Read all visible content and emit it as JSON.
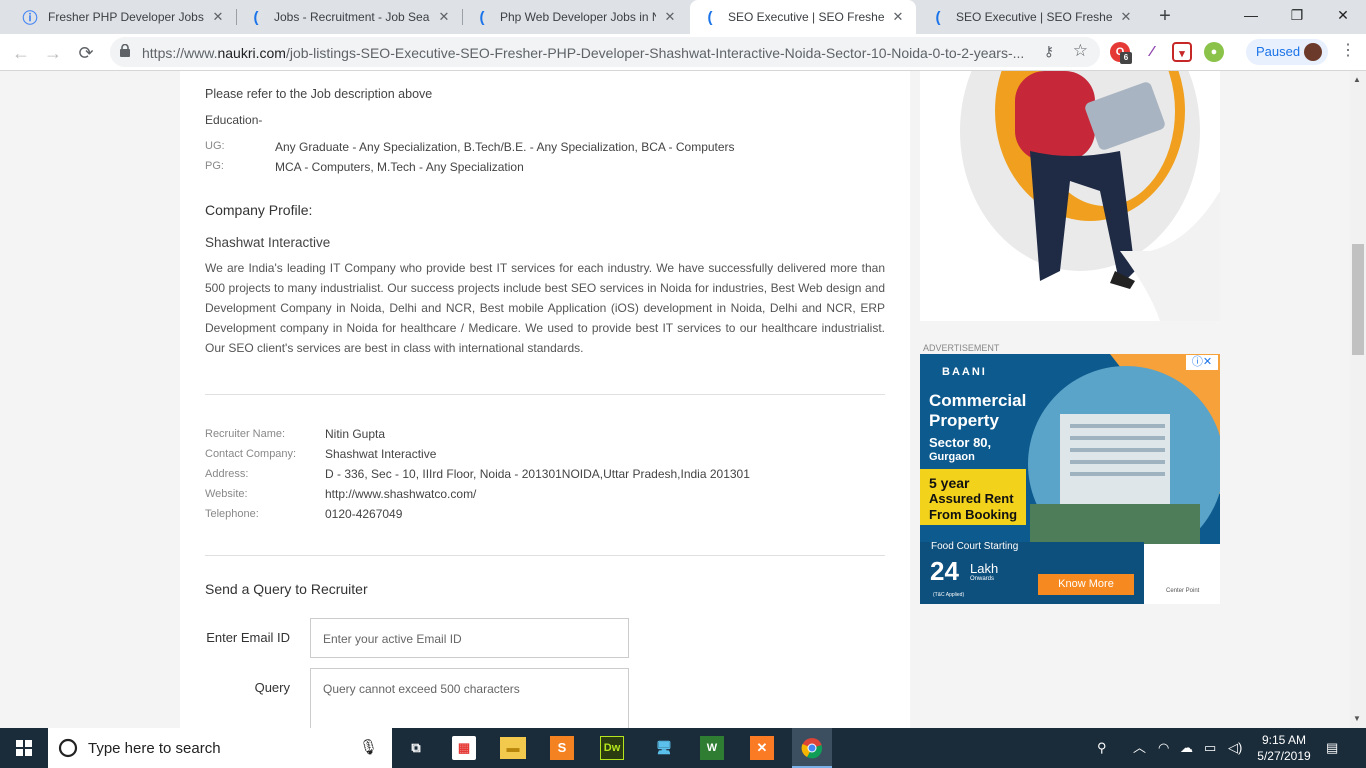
{
  "browser": {
    "tabs": [
      {
        "title": "Fresher PHP Developer Jobs in",
        "active": false
      },
      {
        "title": "Jobs - Recruitment - Job Searc",
        "active": false
      },
      {
        "title": "Php Web Developer Jobs in No",
        "active": false
      },
      {
        "title": "SEO Executive | SEO Fresher | P",
        "active": true
      },
      {
        "title": "SEO Executive | SEO Fresher | P",
        "active": false
      }
    ],
    "url_prefix": "https://www.",
    "url_host": "naukri.com",
    "url_path": "/job-listings-SEO-Executive-SEO-Fresher-PHP-Developer-Shashwat-Interactive-Noida-Sector-10-Noida-0-to-2-years-...",
    "profile_status": "Paused",
    "ext_badge": "6"
  },
  "job": {
    "refer_text": "Please refer to the Job description above",
    "education_heading": "Education-",
    "ug_label": "UG:",
    "ug_value": "Any Graduate - Any Specialization, B.Tech/B.E. - Any Specialization, BCA - Computers",
    "pg_label": "PG:",
    "pg_value": "MCA - Computers, M.Tech - Any Specialization",
    "company_profile_heading": "Company Profile:",
    "company_name": "Shashwat Interactive",
    "company_description": "We are India's leading IT Company who provide best IT services for each industry. We have successfully delivered more than 500 projects to many industrialist. Our success projects include best SEO services in Noida for industries, Best Web design and Development Company in Noida, Delhi and NCR, Best mobile Application (iOS) development in Noida, Delhi and NCR, ERP Development company in Noida for healthcare / Medicare. We used to provide best IT services to our healthcare industrialist. Our SEO client's services are best in class with international standards."
  },
  "recruiter": {
    "name_label": "Recruiter Name:",
    "name": "Nitin Gupta",
    "company_label": "Contact Company:",
    "company": "Shashwat Interactive",
    "address_label": "Address:",
    "address": "D - 336, Sec - 10, IIIrd Floor, Noida - 201301NOIDA,Uttar Pradesh,India 201301",
    "website_label": "Website:",
    "website": "http://www.shashwatco.com/",
    "phone_label": "Telephone:",
    "phone": "0120-4267049"
  },
  "query_form": {
    "heading": "Send a Query to Recruiter",
    "email_label": "Enter Email ID",
    "email_placeholder": "Enter your active Email ID",
    "query_label": "Query",
    "query_placeholder": "Query cannot exceed 500 characters"
  },
  "sidebar": {
    "ad_label": "ADVERTISEMENT",
    "ad": {
      "brand": "BAANI",
      "headline1": "Commercial",
      "headline2": "Property",
      "location1": "Sector 80,",
      "location2": "Gurgaon",
      "offer1": "5 year",
      "offer2": "Assured Rent",
      "offer3": "From Booking",
      "food_court": "Food Court Starting",
      "price_num": "24",
      "price_unit": "Lakh",
      "price_sub": "Onwards",
      "tc": "(T&C Applied)",
      "cta": "Know More",
      "partner": "Center Point"
    }
  },
  "taskbar": {
    "search_placeholder": "Type here to search",
    "time": "9:15 AM",
    "date": "5/27/2019"
  },
  "colors": {
    "accent_blue": "#1a73e8",
    "ad_orange": "#f6a13a",
    "ad_yellow": "#f2d21b",
    "taskbar": "#1a2c3a"
  }
}
